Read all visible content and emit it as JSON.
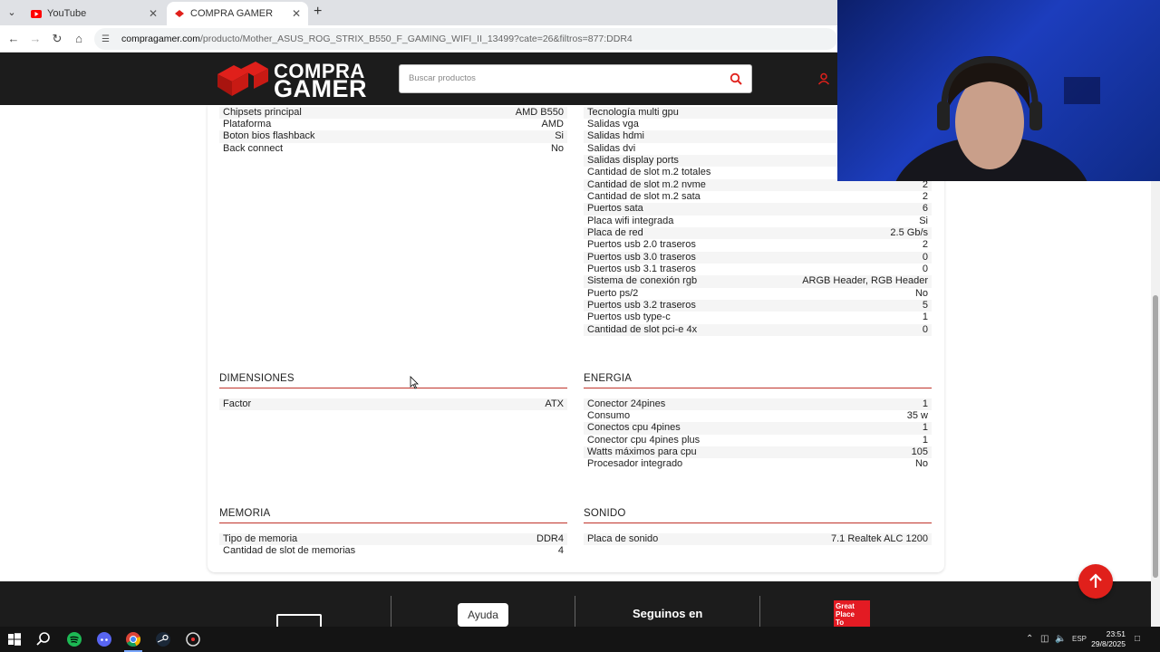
{
  "browser": {
    "tabs": [
      {
        "title": "YouTube",
        "active": false
      },
      {
        "title": "COMPRA GAMER",
        "active": true
      }
    ],
    "url_domain": "compragamer.com",
    "url_path": "/producto/Mother_ASUS_ROG_STRIX_B550_F_GAMING_WIFI_II_13499?cate=26&filtros=877:DDR4"
  },
  "site": {
    "logo_line1": "COMPRA",
    "logo_line2": "GAMER",
    "search_placeholder": "Buscar productos",
    "brand_color": "#e0201b"
  },
  "specs_left_top": [
    {
      "label": "Chipsets principal",
      "value": "AMD B550"
    },
    {
      "label": "Plataforma",
      "value": "AMD"
    },
    {
      "label": "Boton bios flashback",
      "value": "Si"
    },
    {
      "label": "Back connect",
      "value": "No"
    }
  ],
  "specs_right_top": [
    {
      "label": "Tecnología multi gpu",
      "value": ""
    },
    {
      "label": "Salidas vga",
      "value": ""
    },
    {
      "label": "Salidas hdmi",
      "value": ""
    },
    {
      "label": "Salidas dvi",
      "value": ""
    },
    {
      "label": "Salidas display ports",
      "value": ""
    },
    {
      "label": "Cantidad de slot m.2 totales",
      "value": ""
    },
    {
      "label": "Cantidad de slot m.2 nvme",
      "value": "2"
    },
    {
      "label": "Cantidad de slot m.2 sata",
      "value": "2"
    },
    {
      "label": "Puertos sata",
      "value": "6"
    },
    {
      "label": "Placa wifi integrada",
      "value": "Si"
    },
    {
      "label": "Placa de red",
      "value": "2.5 Gb/s"
    },
    {
      "label": "Puertos usb 2.0 traseros",
      "value": "2"
    },
    {
      "label": "Puertos usb 3.0 traseros",
      "value": "0"
    },
    {
      "label": "Puertos usb 3.1 traseros",
      "value": "0"
    },
    {
      "label": "Sistema de conexión rgb",
      "value": "ARGB Header, RGB Header"
    },
    {
      "label": "Puerto ps/2",
      "value": "No"
    },
    {
      "label": "Puertos usb 3.2 traseros",
      "value": "5"
    },
    {
      "label": "Puertos usb type-c",
      "value": "1"
    },
    {
      "label": "Cantidad de slot pci-e 4x",
      "value": "0"
    }
  ],
  "sections": {
    "dimensiones": {
      "title": "DIMENSIONES",
      "rows": [
        {
          "label": "Factor",
          "value": "ATX"
        }
      ]
    },
    "energia": {
      "title": "ENERGIA",
      "rows": [
        {
          "label": "Conector 24pines",
          "value": "1"
        },
        {
          "label": "Consumo",
          "value": "35 w"
        },
        {
          "label": "Conectos cpu 4pines",
          "value": "1"
        },
        {
          "label": "Conector cpu 4pines plus",
          "value": "1"
        },
        {
          "label": "Watts máximos para cpu",
          "value": "105"
        },
        {
          "label": "Procesador integrado",
          "value": "No"
        }
      ]
    },
    "memoria": {
      "title": "MEMORIA",
      "rows": [
        {
          "label": "Tipo de memoria",
          "value": "DDR4"
        },
        {
          "label": "Cantidad de slot de memorias",
          "value": "4"
        }
      ]
    },
    "sonido": {
      "title": "SONIDO",
      "rows": [
        {
          "label": "Placa de sonido",
          "value": "7.1 Realtek ALC 1200"
        }
      ]
    }
  },
  "footer": {
    "help_label": "Ayuda",
    "follow_label": "Seguinos en",
    "gptw_line1": "Great",
    "gptw_line2": "Place",
    "gptw_line3": "To"
  },
  "taskbar": {
    "language": "ESP",
    "time": "23:51",
    "date": "29/8/2025"
  }
}
